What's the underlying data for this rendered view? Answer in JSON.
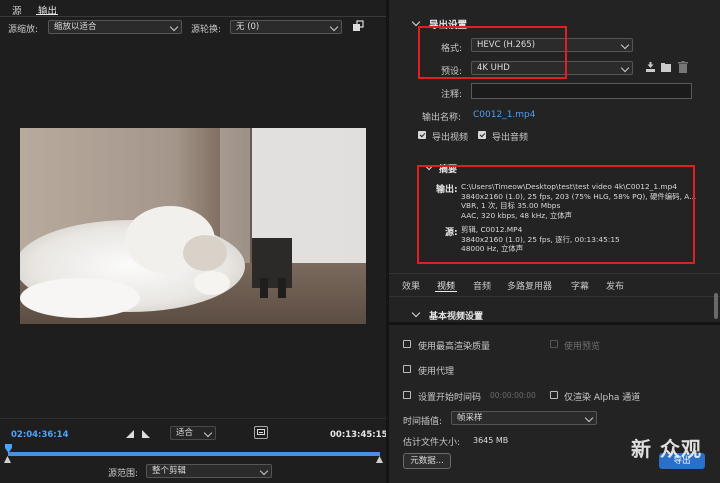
{
  "source_monitor": {
    "tabs": [
      "源",
      "输出"
    ],
    "source_zoom_label": "源缩放:",
    "source_zoom_value": "缩放以适合",
    "source_rotate_label": "源轮换:",
    "source_rotate_value": "无 (0)",
    "timecode_current": "02:04:36:14",
    "fit_value": "适合",
    "timecode_duration": "00:13:45:15",
    "range_label": "源范围:",
    "range_value": "整个剪辑"
  },
  "export_settings": {
    "section_title": "导出设置",
    "format_label": "格式:",
    "format_value": "HEVC (H.265)",
    "preset_label": "预设:",
    "preset_value": "4K UHD",
    "comment_label": "注释:",
    "comment_value": "",
    "output_name_label": "输出名称:",
    "output_name_value": "C0012_1.mp4",
    "export_video_label": "导出视频",
    "export_audio_label": "导出音频"
  },
  "summary": {
    "title": "摘要",
    "output_label": "输出:",
    "output_lines": [
      "C:\\Users\\Timeow\\Desktop\\test\\test video 4k\\C0012_1.mp4",
      "3840x2160 (1.0), 25 fps, 203 (75% HLG, 58% PQ), 硬件编码, A...",
      "VBR, 1 次, 目标 35.00 Mbps",
      "AAC, 320 kbps, 48 kHz, 立体声"
    ],
    "source_label": "源:",
    "source_lines": [
      "剪辑, C0012.MP4",
      "3840x2160 (1.0), 25 fps, 逐行, 00:13:45:15",
      "48000 Hz, 立体声"
    ]
  },
  "tabs": [
    "效果",
    "视频",
    "音频",
    "多路复用器",
    "字幕",
    "发布"
  ],
  "video_basic": {
    "title": "基本视频设置"
  },
  "bottom_options": {
    "max_render_quality": "使用最高渲染质量",
    "use_preview": "使用预览",
    "use_proxy": "使用代理",
    "set_start_timecode": "设置开始时间码",
    "start_timecode_value": "00:00:00:00",
    "render_alpha_only": "仅渲染 Alpha 通道",
    "time_interpolation_label": "时间插值:",
    "time_interpolation_value": "帧采样",
    "file_size_label": "估计文件大小:",
    "file_size_value": "3645 MB",
    "metadata_button": "元数据...",
    "export_button": "导出",
    "watermark": "新 众观"
  }
}
